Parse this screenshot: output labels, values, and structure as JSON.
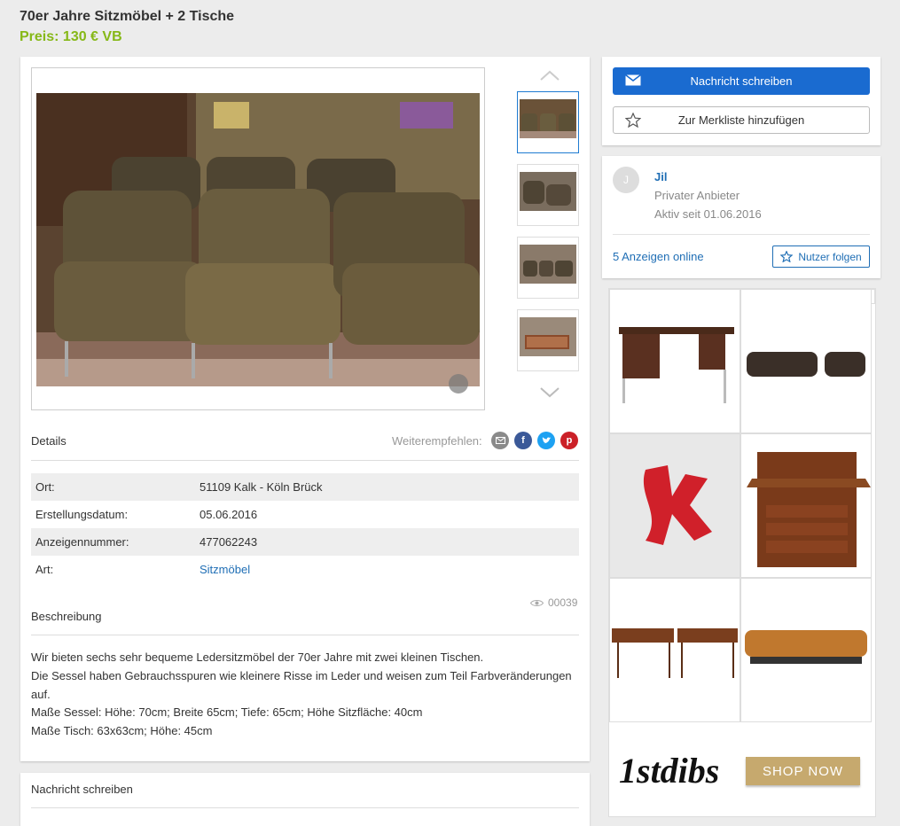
{
  "listing": {
    "title": "70er Jahre Sitzmöbel + 2 Tische",
    "price": "Preis: 130 € VB"
  },
  "gallery": {
    "thumbnail_count": 4,
    "main_image_alt": "Braune Ledersitzmöbel"
  },
  "details": {
    "heading": "Details",
    "share_label": "Weiterempfehlen:",
    "share_icons": [
      "email-icon",
      "facebook-icon",
      "twitter-icon",
      "pinterest-icon"
    ],
    "rows": [
      {
        "key": "Ort:",
        "value": "51109 Kalk - Köln Brück"
      },
      {
        "key": "Erstellungsdatum:",
        "value": "05.06.2016"
      },
      {
        "key": "Anzeigennummer:",
        "value": "477062243"
      },
      {
        "key": "Art:",
        "value": "Sitzmöbel"
      }
    ],
    "views": "00039"
  },
  "description": {
    "heading": "Beschreibung",
    "lines": [
      "Wir bieten sechs sehr bequeme Ledersitzmöbel der 70er Jahre mit zwei kleinen Tischen.",
      "Die Sessel haben Gebrauchsspuren wie kleinere Risse im Leder und weisen zum Teil Farbveränderungen auf.",
      "Maße Sessel: Höhe: 70cm; Breite 65cm; Tiefe: 65cm; Höhe Sitzfläche: 40cm",
      "Maße Tisch: 63x63cm; Höhe: 45cm"
    ]
  },
  "message_section": {
    "heading": "Nachricht schreiben"
  },
  "actions": {
    "message_button": "Nachricht schreiben",
    "watchlist_button": "Zur Merkliste hinzufügen"
  },
  "seller": {
    "avatar_initial": "J",
    "name": "Jil",
    "type": "Privater Anbieter",
    "active_since": "Aktiv seit 01.06.2016",
    "ads_online": "5 Anzeigen online",
    "follow_button": "Nutzer folgen"
  },
  "ad": {
    "brand": "1stdibs",
    "cta": "SHOP NOW",
    "colors": {
      "cta": "#c6a96e"
    }
  },
  "colors": {
    "price": "#86b817",
    "link": "#1f6eb5",
    "primary_button": "#1a6bd0"
  }
}
